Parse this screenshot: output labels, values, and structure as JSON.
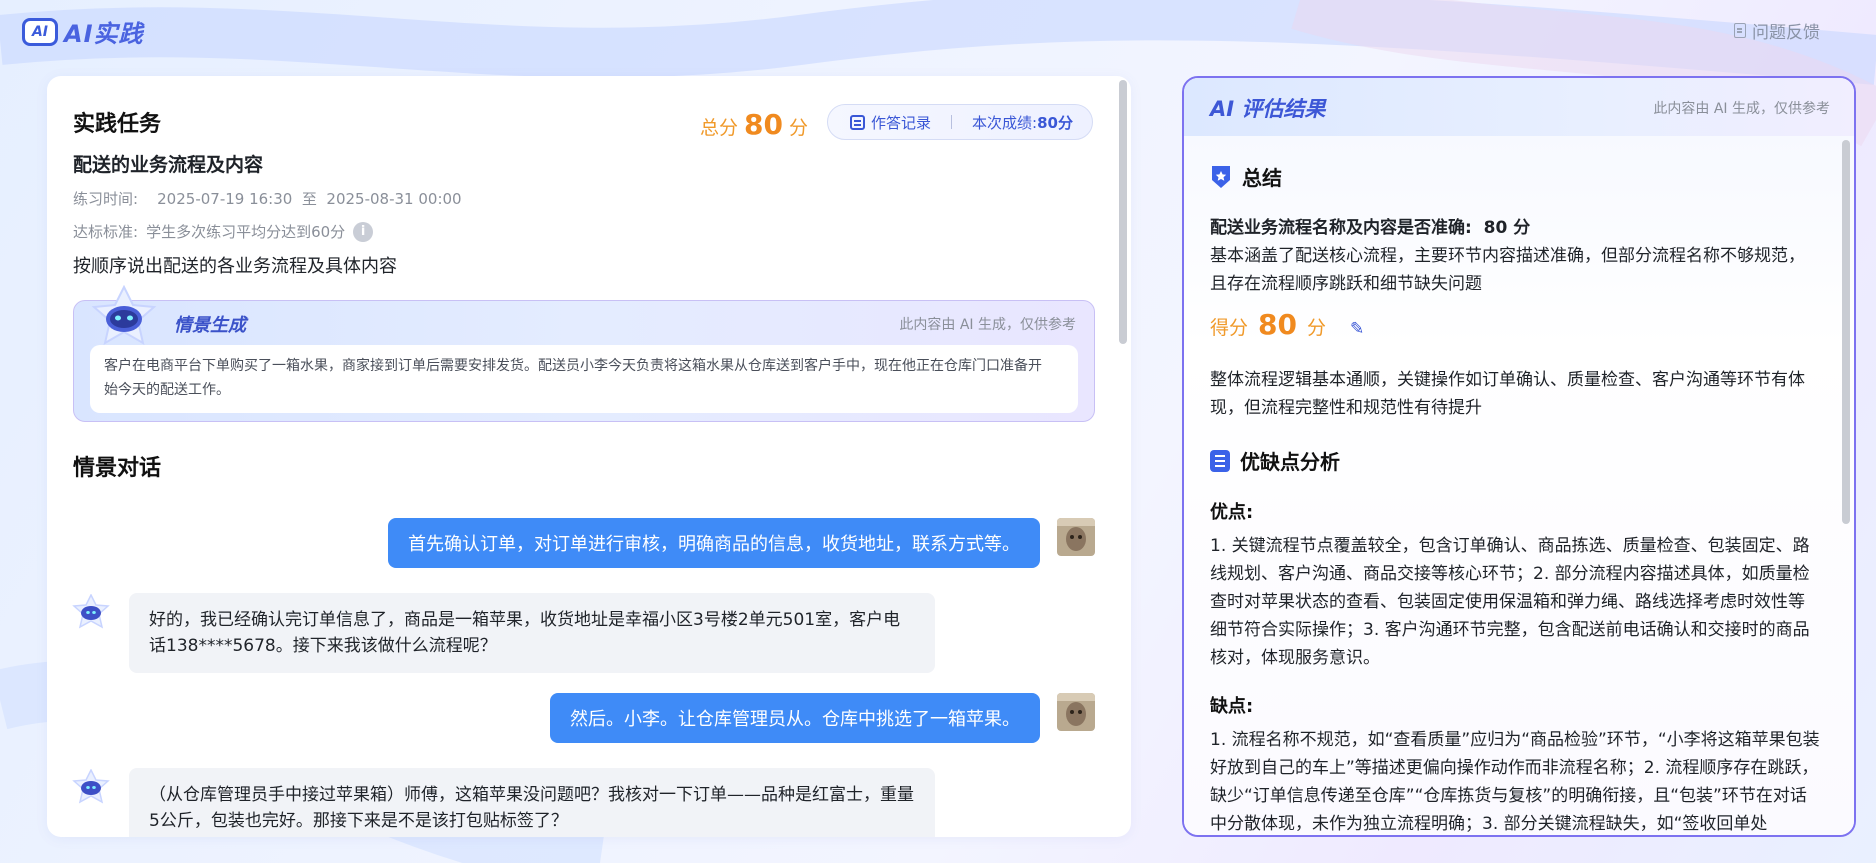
{
  "header": {
    "logo_badge": "AI",
    "logo_text": "AI实践",
    "feedback_label": "问题反馈"
  },
  "task": {
    "section_title": "实践任务",
    "total_label": "总分",
    "total_value": "80",
    "total_unit": "分",
    "record_label": "作答记录",
    "current_score_label": "本次成绩:",
    "current_score_value": "80分",
    "name": "配送的业务流程及内容",
    "time_label": "练习时间:",
    "time_start": "2025-07-19 16:30",
    "time_sep": "至",
    "time_end": "2025-08-31 00:00",
    "standard_label": "达标标准:",
    "standard_value": "学生多次练习平均分达到60分",
    "info_glyph": "i",
    "description": "按顺序说出配送的各业务流程及具体内容"
  },
  "scene": {
    "label": "情景生成",
    "note": "此内容由 AI 生成，仅供参考",
    "text": "客户在电商平台下单购买了一箱水果，商家接到订单后需要安排发货。配送员小李今天负责将这箱水果从仓库送到客户手中，现在他正在仓库门口准备开始今天的配送工作。"
  },
  "dialog": {
    "section_title": "情景对话",
    "messages": [
      {
        "role": "user",
        "text": "首先确认订单，对订单进行审核，明确商品的信息，收货地址，联系方式等。"
      },
      {
        "role": "bot",
        "text": "好的，我已经确认完订单信息了，商品是一箱苹果，收货地址是幸福小区3号楼2单元501室，客户电话138****5678。接下来我该做什么流程呢？"
      },
      {
        "role": "user",
        "text": "然后。小李。让仓库管理员从。仓库中挑选了一箱苹果。"
      },
      {
        "role": "bot",
        "text": "（从仓库管理员手中接过苹果箱）师傅，这箱苹果没问题吧？我核对一下订单——品种是红富士，重量5公斤，包装也完好。那接下来是不是该打包贴标签了？"
      }
    ]
  },
  "evaluation": {
    "title": "AI 评估结果",
    "note": "此内容由 AI 生成，仅供参考",
    "summary_heading": "总结",
    "criterion_label": "配送业务流程名称及内容是否准确:",
    "criterion_score": "80 分",
    "criterion_text": "基本涵盖了配送核心流程，主要环节内容描述准确，但部分流程名称不够规范，且存在流程顺序跳跃和细节缺失问题",
    "score_label": "得分",
    "score_value": "80",
    "score_unit": "分",
    "score_comment": "整体流程逻辑基本通顺，关键操作如订单确认、质量检查、客户沟通等环节有体现，但流程完整性和规范性有待提升",
    "analysis_heading": "优缺点分析",
    "pros_heading": "优点:",
    "pros_text": "1. 关键流程节点覆盖较全，包含订单确认、商品拣选、质量检查、包装固定、路线规划、客户沟通、商品交接等核心环节；2. 部分流程内容描述具体，如质量检查时对苹果状态的查看、包装固定使用保温箱和弹力绳、路线选择考虑时效性等细节符合实际操作；3. 客户沟通环节完整，包含配送前电话确认和交接时的商品核对，体现服务意识。",
    "cons_heading": "缺点:",
    "cons_text": "1. 流程名称不规范，如“查看质量”应归为“商品检验”环节，“小李将这箱苹果包装好放到自己的车上”等描述更偏向操作动作而非流程名称；2. 流程顺序存在跳跃，缺少“订单信息传递至仓库”“仓库拣货与复核”的明确衔接，且“包装”环节在对话中分散体现，未作为独立流程明确；3. 部分关键流程缺失，如“签收回单处"
  },
  "colors": {
    "accent": "#3f8bf7",
    "brand": "#3b57d6",
    "score_orange": "#f08a1f",
    "right_border": "#7d72f0"
  }
}
